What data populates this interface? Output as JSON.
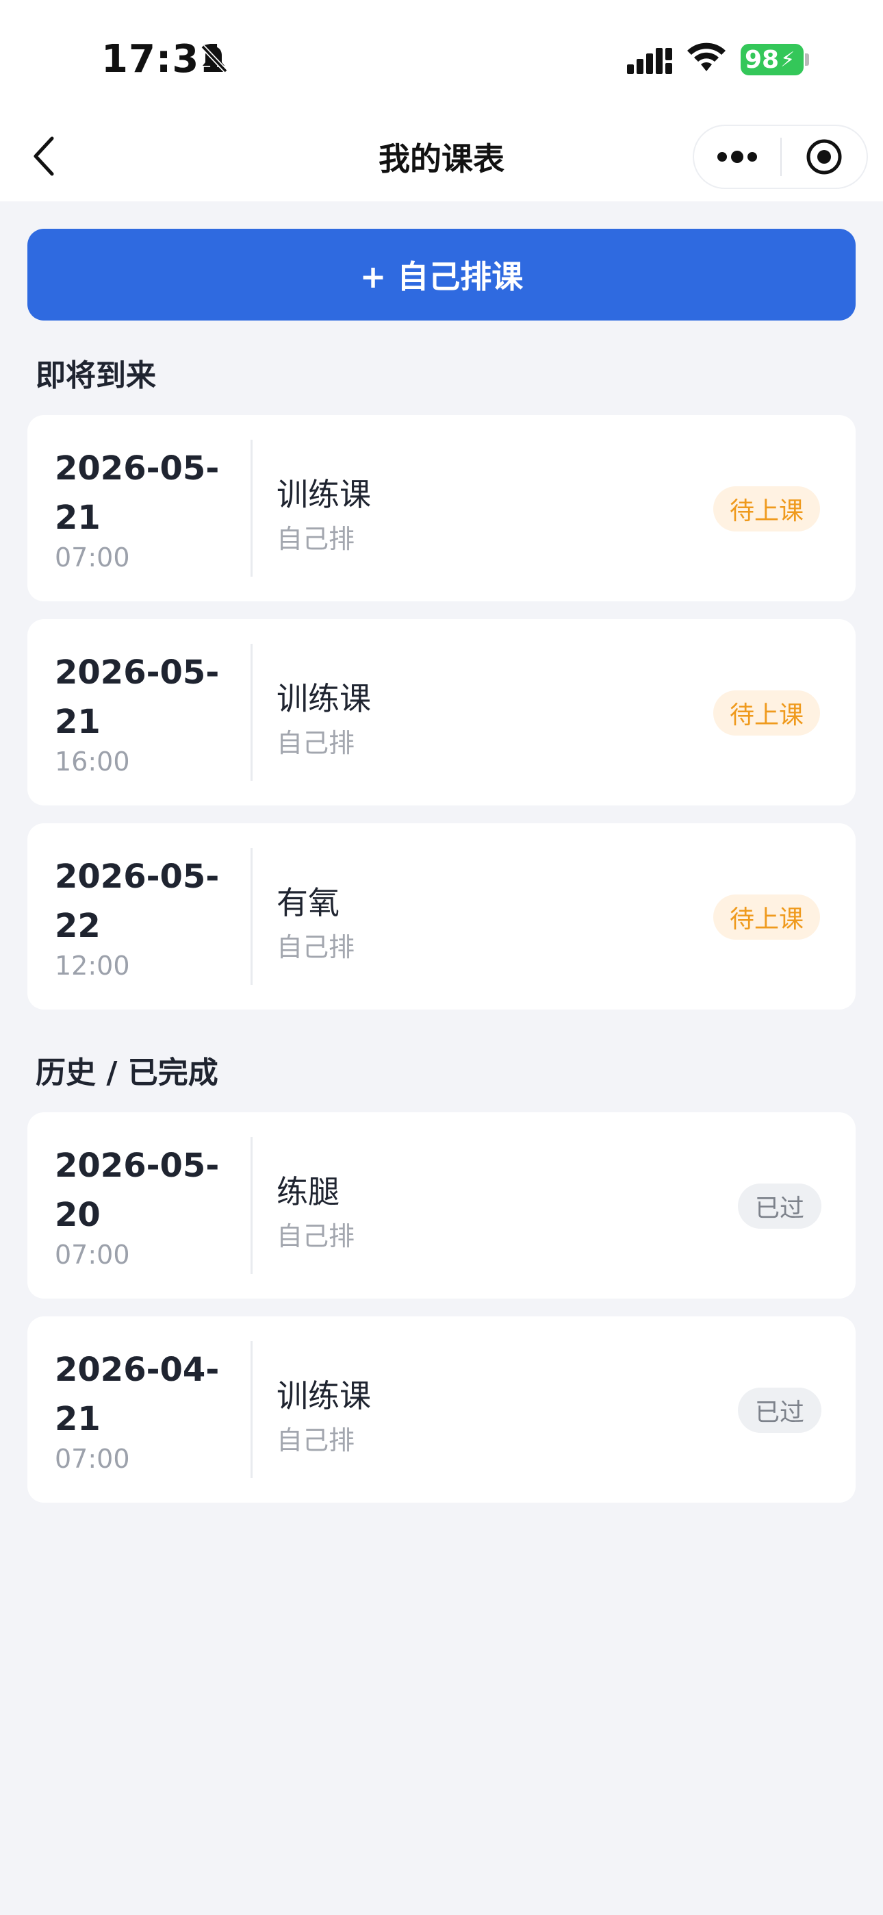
{
  "status_bar": {
    "time": "17:31",
    "battery": "98"
  },
  "nav": {
    "title": "我的课表"
  },
  "add_button": {
    "label": "+ 自己排课"
  },
  "sections": {
    "upcoming_title": "即将到来",
    "history_title": "历史 / 已完成"
  },
  "upcoming": [
    {
      "date_line1": "2026-05-",
      "date_line2": "21",
      "time": "07:00",
      "course": "训练课",
      "source": "自己排",
      "status": "待上课"
    },
    {
      "date_line1": "2026-05-",
      "date_line2": "21",
      "time": "16:00",
      "course": "训练课",
      "source": "自己排",
      "status": "待上课"
    },
    {
      "date_line1": "2026-05-",
      "date_line2": "22",
      "time": "12:00",
      "course": "有氧",
      "source": "自己排",
      "status": "待上课"
    }
  ],
  "history": [
    {
      "date_line1": "2026-05-",
      "date_line2": "20",
      "time": "07:00",
      "course": "练腿",
      "source": "自己排",
      "status": "已过"
    },
    {
      "date_line1": "2026-04-",
      "date_line2": "21",
      "time": "07:00",
      "course": "训练课",
      "source": "自己排",
      "status": "已过"
    }
  ],
  "colors": {
    "accent": "#2f6ae0",
    "upcoming_badge_bg": "#fff2e2",
    "upcoming_badge_text": "#ef9a1d",
    "past_badge_bg": "#eef0f3",
    "past_badge_text": "#7d828b",
    "page_bg": "#f3f4f8"
  }
}
